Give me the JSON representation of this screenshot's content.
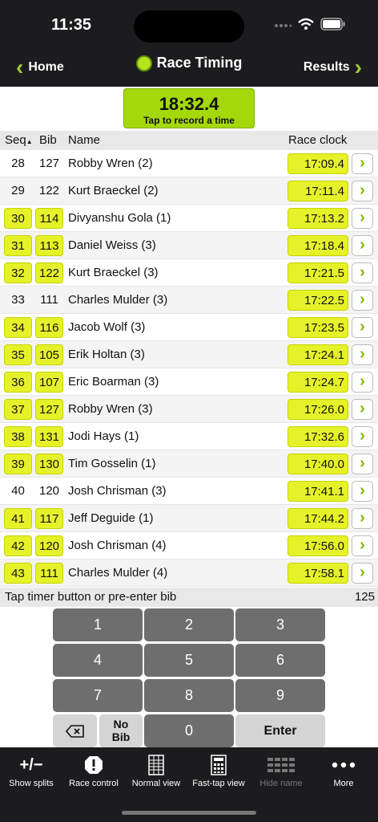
{
  "status": {
    "time": "11:35"
  },
  "nav": {
    "back_label": "Home",
    "title": "Race Timing",
    "forward_label": "Results"
  },
  "timer": {
    "value": "18:32.4",
    "caption": "Tap to record a time"
  },
  "columns": {
    "seq": "Seq",
    "bib": "Bib",
    "name": "Name",
    "clock": "Race clock"
  },
  "rows": [
    {
      "seq": "28",
      "bib": "127",
      "name": "Robby Wren (2)",
      "time": "17:09.4",
      "hl": false
    },
    {
      "seq": "29",
      "bib": "122",
      "name": "Kurt Braeckel (2)",
      "time": "17:11.4",
      "hl": false
    },
    {
      "seq": "30",
      "bib": "114",
      "name": "Divyanshu Gola (1)",
      "time": "17:13.2",
      "hl": true
    },
    {
      "seq": "31",
      "bib": "113",
      "name": "Daniel Weiss (3)",
      "time": "17:18.4",
      "hl": true
    },
    {
      "seq": "32",
      "bib": "122",
      "name": "Kurt Braeckel (3)",
      "time": "17:21.5",
      "hl": true
    },
    {
      "seq": "33",
      "bib": "111",
      "name": "Charles Mulder (3)",
      "time": "17:22.5",
      "hl": false
    },
    {
      "seq": "34",
      "bib": "116",
      "name": "Jacob Wolf (3)",
      "time": "17:23.5",
      "hl": true
    },
    {
      "seq": "35",
      "bib": "105",
      "name": "Erik Holtan (3)",
      "time": "17:24.1",
      "hl": true
    },
    {
      "seq": "36",
      "bib": "107",
      "name": "Eric Boarman (3)",
      "time": "17:24.7",
      "hl": true
    },
    {
      "seq": "37",
      "bib": "127",
      "name": "Robby Wren (3)",
      "time": "17:26.0",
      "hl": true
    },
    {
      "seq": "38",
      "bib": "131",
      "name": "Jodi Hays (1)",
      "time": "17:32.6",
      "hl": true
    },
    {
      "seq": "39",
      "bib": "130",
      "name": "Tim Gosselin (1)",
      "time": "17:40.0",
      "hl": true
    },
    {
      "seq": "40",
      "bib": "120",
      "name": "Josh Chrisman (3)",
      "time": "17:41.1",
      "hl": false
    },
    {
      "seq": "41",
      "bib": "117",
      "name": "Jeff Deguide (1)",
      "time": "17:44.2",
      "hl": true
    },
    {
      "seq": "42",
      "bib": "120",
      "name": "Josh Chrisman (4)",
      "time": "17:56.0",
      "hl": true
    },
    {
      "seq": "43",
      "bib": "111",
      "name": "Charles Mulder (4)",
      "time": "17:58.1",
      "hl": true
    }
  ],
  "hint": {
    "text": "Tap timer button or pre-enter bib",
    "count": "125"
  },
  "keypad": {
    "digits": [
      "1",
      "2",
      "3",
      "4",
      "5",
      "6",
      "7",
      "8",
      "9"
    ],
    "no_bib_line1": "No",
    "no_bib_line2": "Bib",
    "zero": "0",
    "enter": "Enter"
  },
  "tabs": {
    "show_splits": "Show splits",
    "show_splits_glyph": "+/−",
    "race_control": "Race control",
    "normal_view": "Normal view",
    "fast_tap_view": "Fast-tap view",
    "hide_name": "Hide name",
    "more": "More"
  },
  "colors": {
    "accent": "#9acd32",
    "highlight": "#e6f229",
    "timer_button": "#a4d80a"
  }
}
